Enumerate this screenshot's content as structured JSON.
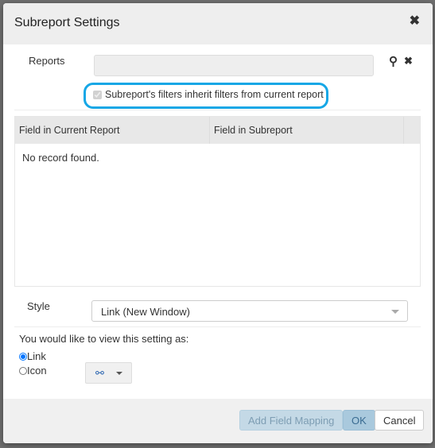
{
  "dialog": {
    "title": "Subreport Settings",
    "reports_label": "Reports",
    "reports_value": "",
    "inherit_label": "Subreport's filters inherit filters from current report",
    "inherit_checked": true,
    "grid": {
      "columns": [
        "Field in Current Report",
        "Field in Subreport"
      ],
      "empty_text": "No record found."
    },
    "style_label": "Style",
    "style_value": "Link (New Window)",
    "view_label": "You would like to view this setting as:",
    "options": [
      "Link",
      "Icon"
    ],
    "selected_option": "Link",
    "buttons": {
      "add": "Add Field Mapping",
      "ok": "OK",
      "cancel": "Cancel"
    },
    "colors": {
      "highlight": "#16a7e6",
      "primary_btn": "#a9c9dd"
    }
  }
}
